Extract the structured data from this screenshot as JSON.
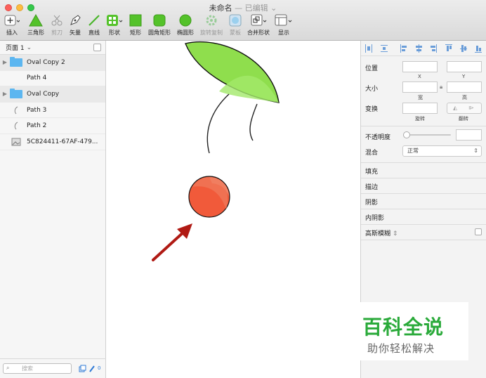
{
  "window": {
    "title": "未命名",
    "status": "— 已编辑"
  },
  "toolbar": [
    {
      "label": "插入",
      "icon": "plus-icon"
    },
    {
      "label": "三角形",
      "icon": "triangle-icon"
    },
    {
      "label": "剪刀",
      "icon": "scissors-icon"
    },
    {
      "label": "矢量",
      "icon": "pen-icon"
    },
    {
      "label": "直线",
      "icon": "line-icon"
    },
    {
      "label": "形状",
      "icon": "shapes-icon"
    },
    {
      "label": "矩形",
      "icon": "rectangle-icon"
    },
    {
      "label": "圆角矩形",
      "icon": "rounded-rectangle-icon"
    },
    {
      "label": "椭圆形",
      "icon": "oval-icon"
    },
    {
      "label": "旋转复制",
      "icon": "rotate-copy-icon"
    },
    {
      "label": "蒙板",
      "icon": "mask-icon"
    },
    {
      "label": "合并形状",
      "icon": "combine-shapes-icon"
    },
    {
      "label": "显示",
      "icon": "view-icon"
    }
  ],
  "sidebar": {
    "page_selector": "页面 1",
    "layers": [
      {
        "name": "Oval Copy 2",
        "type": "group"
      },
      {
        "name": "Path 4",
        "type": "path-plain"
      },
      {
        "name": "Oval Copy",
        "type": "group"
      },
      {
        "name": "Path 3",
        "type": "path"
      },
      {
        "name": "Path 2",
        "type": "path"
      },
      {
        "name": "5C824411-67AF-479...",
        "type": "image"
      }
    ],
    "search_placeholder": "搜索",
    "filter_count": "0"
  },
  "inspector": {
    "position_label": "位置",
    "x_label": "X",
    "y_label": "Y",
    "size_label": "大小",
    "width_label": "宽",
    "height_label": "高",
    "transform_label": "变换",
    "rotate_label": "旋转",
    "flip_label": "翻转",
    "opacity_label": "不透明度",
    "opacity_slider_value": 0,
    "blend_label": "混合",
    "blend_value": "正常",
    "sections": [
      "填充",
      "描边",
      "阴影",
      "内阴影",
      "高斯模糊"
    ]
  },
  "watermark": {
    "title": "百科全说",
    "subtitle": "助你轻松解决"
  },
  "colors": {
    "leaf_fill": "#8fde4d",
    "leaf_highlight": "#a3e86a",
    "cherry_fill": "#f15a3a",
    "cherry_highlight": "#f18a6e",
    "arrow": "#b01a14",
    "accent_blue": "#6a9dd9",
    "watermark_green": "#2aaa3a"
  }
}
